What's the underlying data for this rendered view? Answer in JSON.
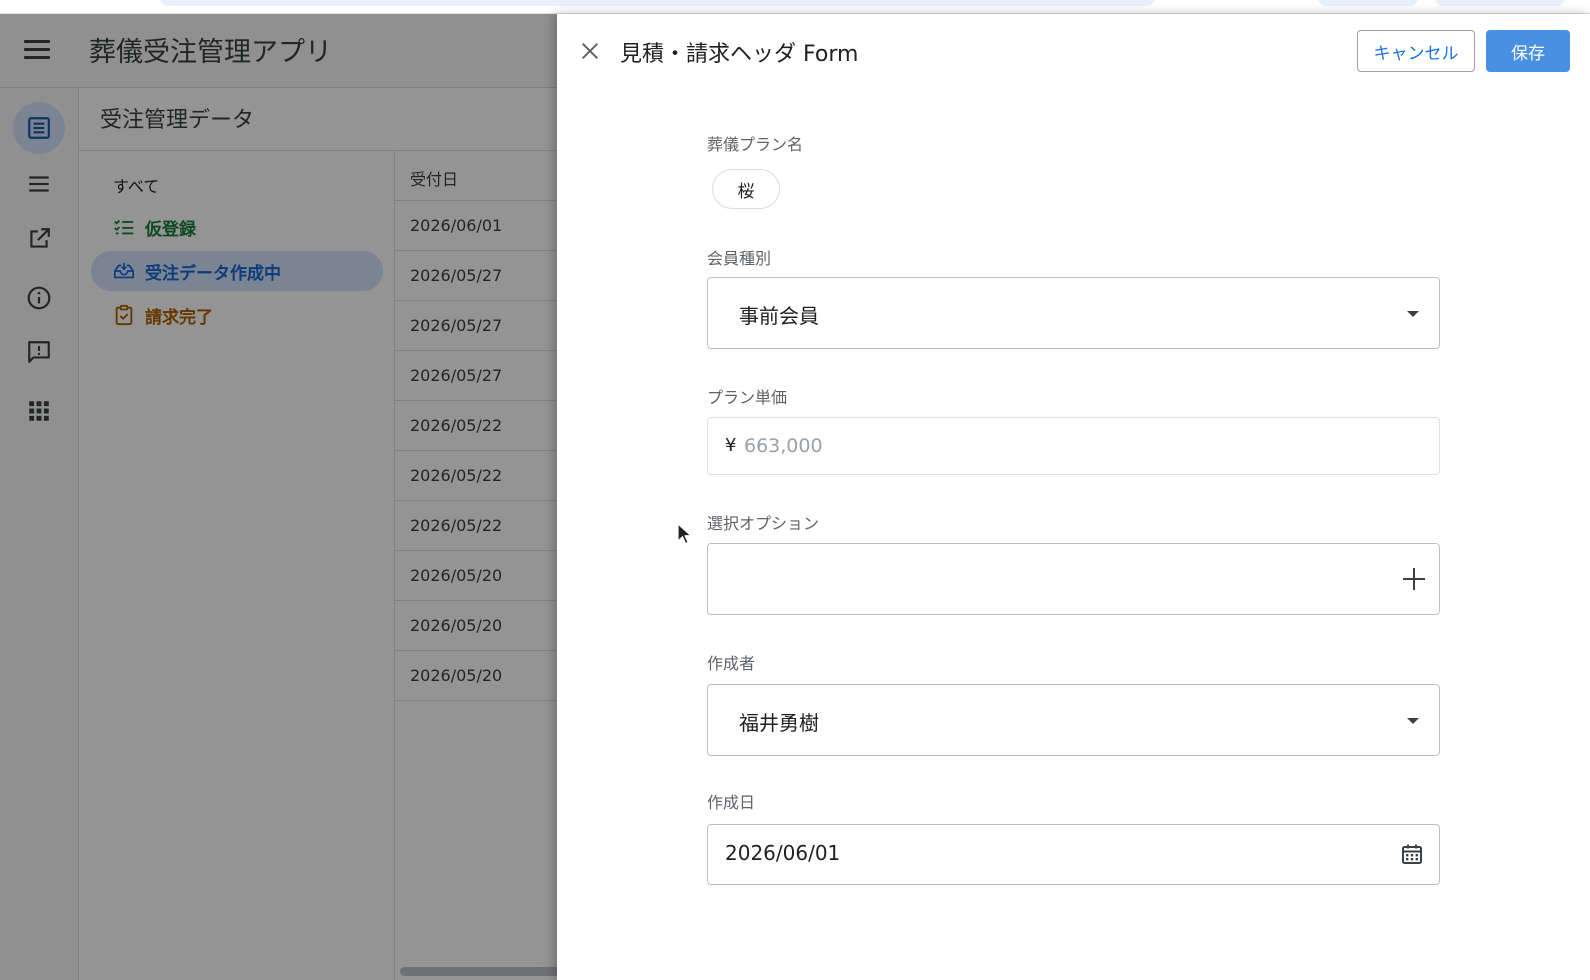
{
  "app": {
    "title": "葬儀受注管理アプリ",
    "content_title": "受注管理データ"
  },
  "rail": {
    "items": [
      {
        "icon": "list-alt-icon",
        "active": true
      },
      {
        "icon": "menu-lines-icon",
        "active": false
      },
      {
        "icon": "open-in-new-icon",
        "active": false
      },
      {
        "icon": "info-icon",
        "active": false
      },
      {
        "icon": "feedback-icon",
        "active": false
      },
      {
        "icon": "apps-grid-icon",
        "active": false
      }
    ]
  },
  "filters": {
    "all": "すべて",
    "temp": "仮登録",
    "active": "受注データ作成中",
    "done": "請求完了",
    "colors": {
      "temp": "#188038",
      "active": "#1967d2",
      "done": "#b06000"
    }
  },
  "table": {
    "header": "受付日",
    "rows": [
      "2026/06/01",
      "2026/05/27",
      "2026/05/27",
      "2026/05/27",
      "2026/05/22",
      "2026/05/22",
      "2026/05/22",
      "2026/05/20",
      "2026/05/20",
      "2026/05/20"
    ]
  },
  "drawer": {
    "title": "見積・請求ヘッダ Form",
    "cancel_label": "キャンセル",
    "save_label": "保存",
    "fields": {
      "plan_name": {
        "label": "葬儀プラン名",
        "value": "桜"
      },
      "member_type": {
        "label": "会員種別",
        "value": "事前会員"
      },
      "unit_price": {
        "label": "プラン単価",
        "currency": "¥",
        "placeholder": "663,000",
        "value": ""
      },
      "options": {
        "label": "選択オプション"
      },
      "author": {
        "label": "作成者",
        "value": "福井勇樹"
      },
      "created_date": {
        "label": "作成日",
        "value": "2026/06/01"
      }
    },
    "colors": {
      "accent": "#4a90e2",
      "link": "#1a73e8"
    }
  }
}
